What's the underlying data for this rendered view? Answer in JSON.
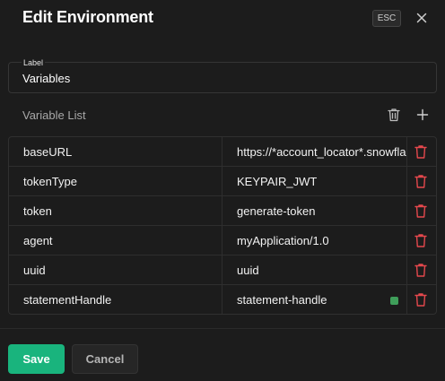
{
  "dialog": {
    "title": "Edit Environment",
    "esc_label": "ESC",
    "close_icon": "close-icon"
  },
  "label_field": {
    "caption": "Label",
    "value": "Variables"
  },
  "variables": {
    "section_title": "Variable List",
    "delete_all_icon": "trash-icon",
    "add_icon": "plus-icon",
    "rows": [
      {
        "key": "baseURL",
        "value": "https://*account_locator*.snowflakecomputing.com"
      },
      {
        "key": "tokenType",
        "value": "KEYPAIR_JWT"
      },
      {
        "key": "token",
        "value": "generate-token"
      },
      {
        "key": "agent",
        "value": "myApplication/1.0"
      },
      {
        "key": "uuid",
        "value": "uuid"
      },
      {
        "key": "statementHandle",
        "value": "statement-handle"
      }
    ]
  },
  "footer": {
    "save_label": "Save",
    "cancel_label": "Cancel"
  },
  "colors": {
    "accent": "#19b47d",
    "danger": "#e5484d",
    "status_green": "#3f9e5a",
    "background": "#1c1c1c"
  }
}
